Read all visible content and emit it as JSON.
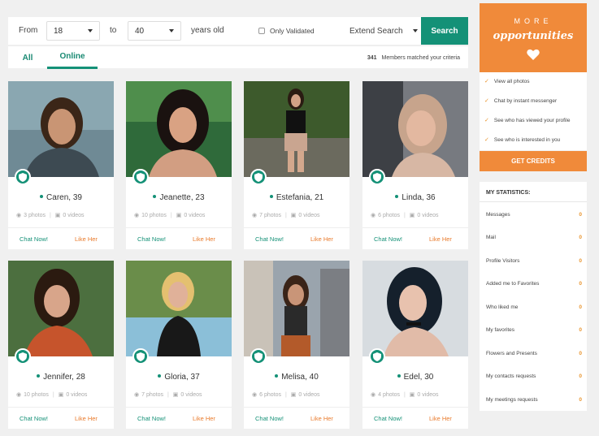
{
  "search": {
    "from_label": "From",
    "from_value": "18",
    "to_label": "to",
    "to_value": "40",
    "years_label": "years old",
    "only_validated": "Only Validated",
    "extend_label": "Extend Search",
    "search_button": "Search"
  },
  "tabs": {
    "all": "All",
    "online": "Online",
    "matched_count": "341",
    "matched_text": "Members matched your criteria"
  },
  "cards": [
    {
      "name": "Caren, 39",
      "photos": "3 photos",
      "videos": "0 videos",
      "chat": "Chat Now!",
      "like": "Like Her"
    },
    {
      "name": "Jeanette, 23",
      "photos": "10 photos",
      "videos": "0 videos",
      "chat": "Chat Now!",
      "like": "Like Her"
    },
    {
      "name": "Estefania, 21",
      "photos": "7 photos",
      "videos": "0 videos",
      "chat": "Chat Now!",
      "like": "Like Her"
    },
    {
      "name": "Linda, 36",
      "photos": "6 photos",
      "videos": "0 videos",
      "chat": "Chat Now!",
      "like": "Like Her"
    },
    {
      "name": "Jennifer, 28",
      "photos": "10 photos",
      "videos": "0 videos",
      "chat": "Chat Now!",
      "like": "Like Her"
    },
    {
      "name": "Gloria, 37",
      "photos": "7 photos",
      "videos": "0 videos",
      "chat": "Chat Now!",
      "like": "Like Her"
    },
    {
      "name": "Melisa, 40",
      "photos": "6 photos",
      "videos": "0 videos",
      "chat": "Chat Now!",
      "like": "Like Her"
    },
    {
      "name": "Edel, 30",
      "photos": "4 photos",
      "videos": "0 videos",
      "chat": "Chat Now!",
      "like": "Like Her"
    }
  ],
  "promo": {
    "more": "MORE",
    "opportunities": "opportunities",
    "features": [
      "View all photos",
      "Chat by instant messenger",
      "See who has viewed your profile",
      "See who is interested in you"
    ],
    "credits_button": "GET CREDITS"
  },
  "stats": {
    "title": "MY STATISTICS:",
    "rows": [
      {
        "label": "Messages",
        "value": "0"
      },
      {
        "label": "Mail",
        "value": "0"
      },
      {
        "label": "Profile Visitors",
        "value": "0"
      },
      {
        "label": "Added me to Favorites",
        "value": "0"
      },
      {
        "label": "Who liked me",
        "value": "0"
      },
      {
        "label": "My favorites",
        "value": "0"
      },
      {
        "label": "Flowers and Presents",
        "value": "0"
      },
      {
        "label": "My contacts requests",
        "value": "0"
      },
      {
        "label": "My meetings requests",
        "value": "0"
      }
    ]
  },
  "colors": {
    "accent": "#149177",
    "orange": "#f08a3a"
  }
}
